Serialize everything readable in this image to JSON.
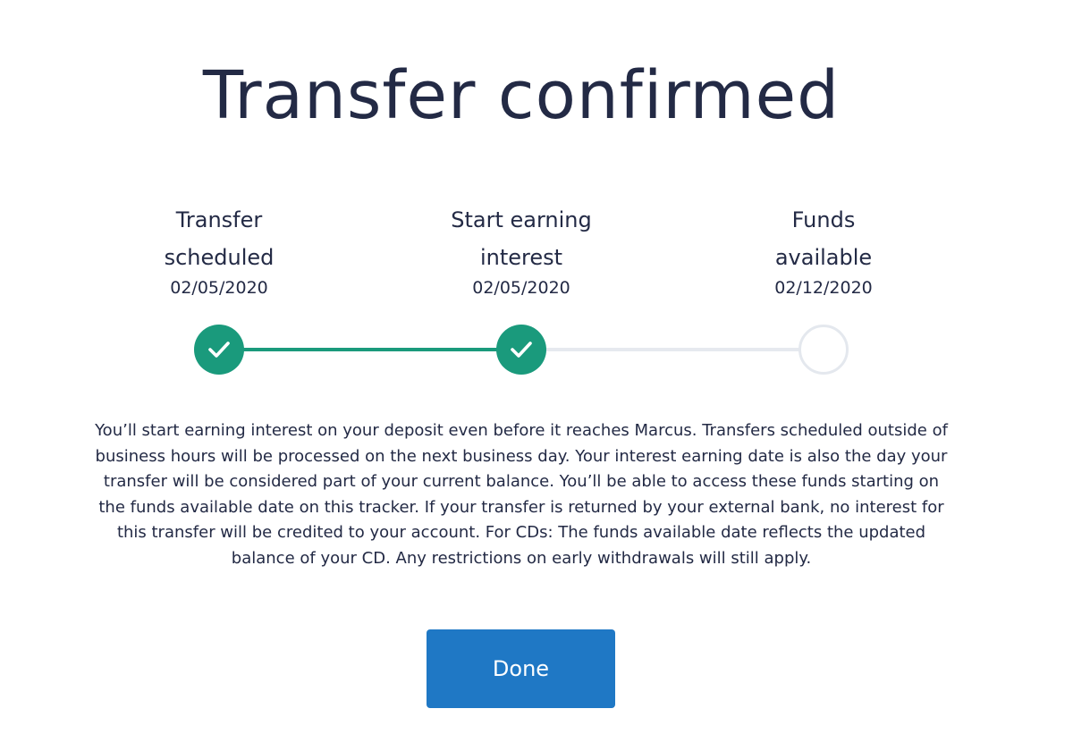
{
  "page": {
    "title": "Transfer confirmed"
  },
  "tracker": {
    "steps": [
      {
        "label_line1": "Transfer",
        "label_line2": "scheduled",
        "date": "02/05/2020",
        "status": "complete",
        "icon": "check-icon"
      },
      {
        "label_line1": "Start earning",
        "label_line2": "interest",
        "date": "02/05/2020",
        "status": "complete",
        "icon": "check-icon"
      },
      {
        "label_line1": "Funds",
        "label_line2": "available",
        "date": "02/12/2020",
        "status": "pending",
        "icon": "empty-circle-icon"
      }
    ],
    "colors": {
      "complete": "#1a9a7c",
      "pending_border": "#e4e8ee"
    }
  },
  "description": "You’ll start earning interest on your deposit even before it reaches Marcus. Transfers scheduled outside of business hours will be processed on the next business day. Your interest earning date is also the day your transfer will be considered part of your current balance. You’ll be able to access these funds starting on the funds available date on this tracker. If your transfer is returned by your external bank, no interest for this transfer will be credited to your account. For CDs: The funds available date reflects the updated balance of your CD. Any restrictions on early withdrawals will still apply.",
  "actions": {
    "done_label": "Done",
    "done_color": "#1f78c5"
  }
}
